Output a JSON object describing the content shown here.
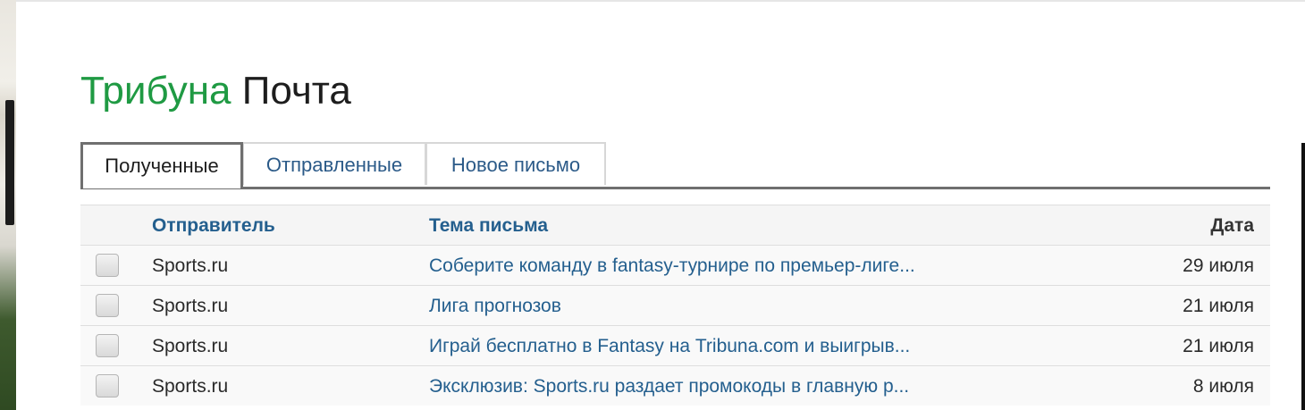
{
  "header": {
    "brand": "Трибуна",
    "section": "Почта"
  },
  "tabs": [
    {
      "label": "Полученные",
      "active": true
    },
    {
      "label": "Отправленные",
      "active": false
    },
    {
      "label": "Новое письмо",
      "active": false
    }
  ],
  "table": {
    "columns": {
      "sender": "Отправитель",
      "subject": "Тема письма",
      "date": "Дата"
    },
    "rows": [
      {
        "sender": "Sports.ru",
        "subject": "Соберите команду в fantasy-турнире по премьер-лиге...",
        "date": "29 июля"
      },
      {
        "sender": "Sports.ru",
        "subject": "Лига прогнозов",
        "date": "21 июля"
      },
      {
        "sender": "Sports.ru",
        "subject": "Играй бесплатно в Fantasy на Tribuna.com и выигрыв...",
        "date": "21 июля"
      },
      {
        "sender": "Sports.ru",
        "subject": "Эксклюзив: Sports.ru раздает промокоды в главную р...",
        "date": "8 июля"
      }
    ]
  },
  "colors": {
    "brand": "#1f9a43",
    "link": "#245f8e"
  }
}
